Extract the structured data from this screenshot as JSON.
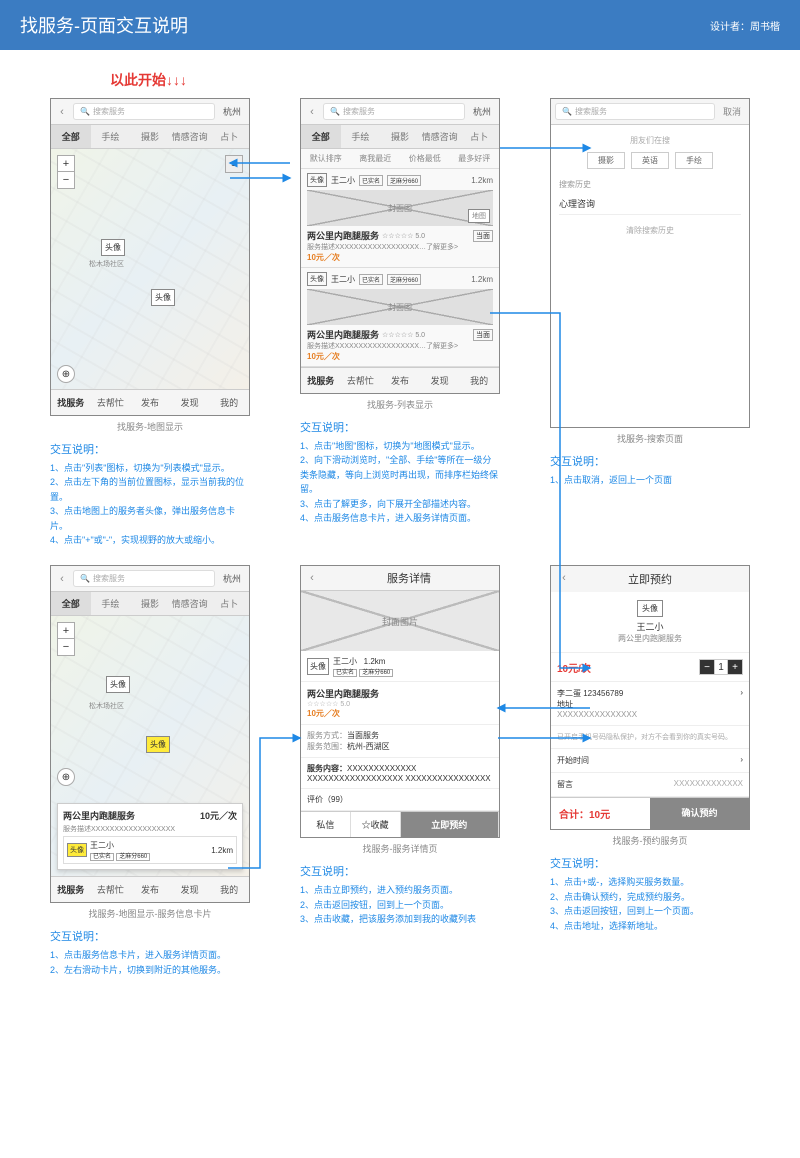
{
  "header": {
    "title": "找服务-页面交互说明",
    "designer": "设计者：周书楷"
  },
  "start_hint": "以此开始↓↓↓",
  "common": {
    "search_placeholder": "搜索服务",
    "city": "杭州",
    "tabs": [
      "全部",
      "手绘",
      "摄影",
      "情感咨询",
      "占卜"
    ],
    "bottomnav": [
      "找服务",
      "去帮忙",
      "发布",
      "发现",
      "我的"
    ],
    "avatar": "头像"
  },
  "screen_map": {
    "caption": "找服务-地图显示",
    "explain_title": "交互说明：",
    "explain": "1、点击\"列表\"图标，切换为\"列表模式\"显示。\n2、点击左下角的当前位置图标，显示当前我的位置。\n3、点击地图上的服务者头像，弹出服务信息卡片。\n4、点击\"+\"或\"-\"，实现视野的放大或缩小。"
  },
  "screen_list": {
    "caption": "找服务-列表显示",
    "sort": [
      "默认排序",
      "离我最近",
      "价格最低",
      "最多好评"
    ],
    "item": {
      "name": "王二小",
      "realname": "已实名",
      "credit": "芝麻分660",
      "dist": "1.2km",
      "cover": "封面图",
      "mapbtn": "地图",
      "title": "两公里内跑腿服务",
      "rating": "☆☆☆☆☆ 5.0",
      "tag": "当面",
      "desc": "服务描述XXXXXXXXXXXXXXXXXX…了解更多>",
      "price": "10元／次"
    },
    "explain_title": "交互说明：",
    "explain": "1、点击\"地图\"图标，切换为\"地图模式\"显示。\n2、向下滑动浏览时，\"全部、手绘\"等所在一级分类条隐藏，等向上浏览时再出现，而排序栏始终保留。\n3、点击了解更多，向下展开全部描述内容。\n4、点击服务信息卡片，进入服务详情页面。"
  },
  "screen_search": {
    "caption": "找服务-搜索页面",
    "cancel": "取消",
    "friends": "朋友们在搜",
    "chips": [
      "摄影",
      "英语",
      "手绘"
    ],
    "histlabel": "搜索历史",
    "histitem": "心理咨询",
    "clear": "清除搜索历史",
    "explain_title": "交互说明：",
    "explain": "1、点击取消，返回上一个页面"
  },
  "screen_mapcard": {
    "caption": "找服务-地图显示-服务信息卡片",
    "card": {
      "title": "两公里内跑腿服务",
      "price": "10元／次",
      "desc": "服务描述XXXXXXXXXXXXXXXXXX",
      "name": "王二小",
      "realname": "已实名",
      "credit": "芝麻分660",
      "dist": "1.2km"
    },
    "explain_title": "交互说明：",
    "explain": "1、点击服务信息卡片，进入服务详情页面。\n2、左右滑动卡片，切换到附近的其他服务。"
  },
  "screen_detail": {
    "caption": "找服务-服务详情页",
    "title": "服务详情",
    "cover": "封面图片",
    "user": {
      "name": "王二小",
      "dist": "1.2km",
      "realname": "已实名",
      "credit": "芝麻分660"
    },
    "service_title": "两公里内跑腿服务",
    "rating": "☆☆☆☆☆ 5.0",
    "price": "10元／次",
    "method_label": "服务方式：",
    "method": "当面服务",
    "range_label": "服务范围：",
    "range": "杭州-西湖区",
    "content_label": "服务内容：",
    "content": "XXXXXXXXXXXXX XXXXXXXXXXXXXXXXXX XXXXXXXXXXXXXXXX",
    "reviews": "评价（99）",
    "actions": {
      "pm": "私信",
      "fav": "☆收藏",
      "book": "立即预约"
    },
    "explain_title": "交互说明：",
    "explain": "1、点击立即预约，进入预约服务页面。\n2、点击返回按钮，回到上一个页面。\n3、点击收藏，把该服务添加到我的收藏列表"
  },
  "screen_book": {
    "caption": "找服务-预约服务页",
    "title": "立即预约",
    "user": "王二小",
    "service": "两公里内跑腿服务",
    "price": "10元/次",
    "contact": "李二蛋 123456789",
    "addr_label": "地址",
    "addr": "XXXXXXXXXXXXXXX",
    "note": "已开启手机号码隐私保护，对方不会看到你的真实号码。",
    "start": "开始时间",
    "msg_label": "留言",
    "msg": "XXXXXXXXXXXXX",
    "total": "合计：10元",
    "confirm": "确认预约",
    "explain_title": "交互说明：",
    "explain": "1、点击+或-，选择购买服务数量。\n2、点击确认预约，完成预约服务。\n3、点击返回按钮，回到上一个页面。\n4、点击地址，选择新地址。"
  }
}
